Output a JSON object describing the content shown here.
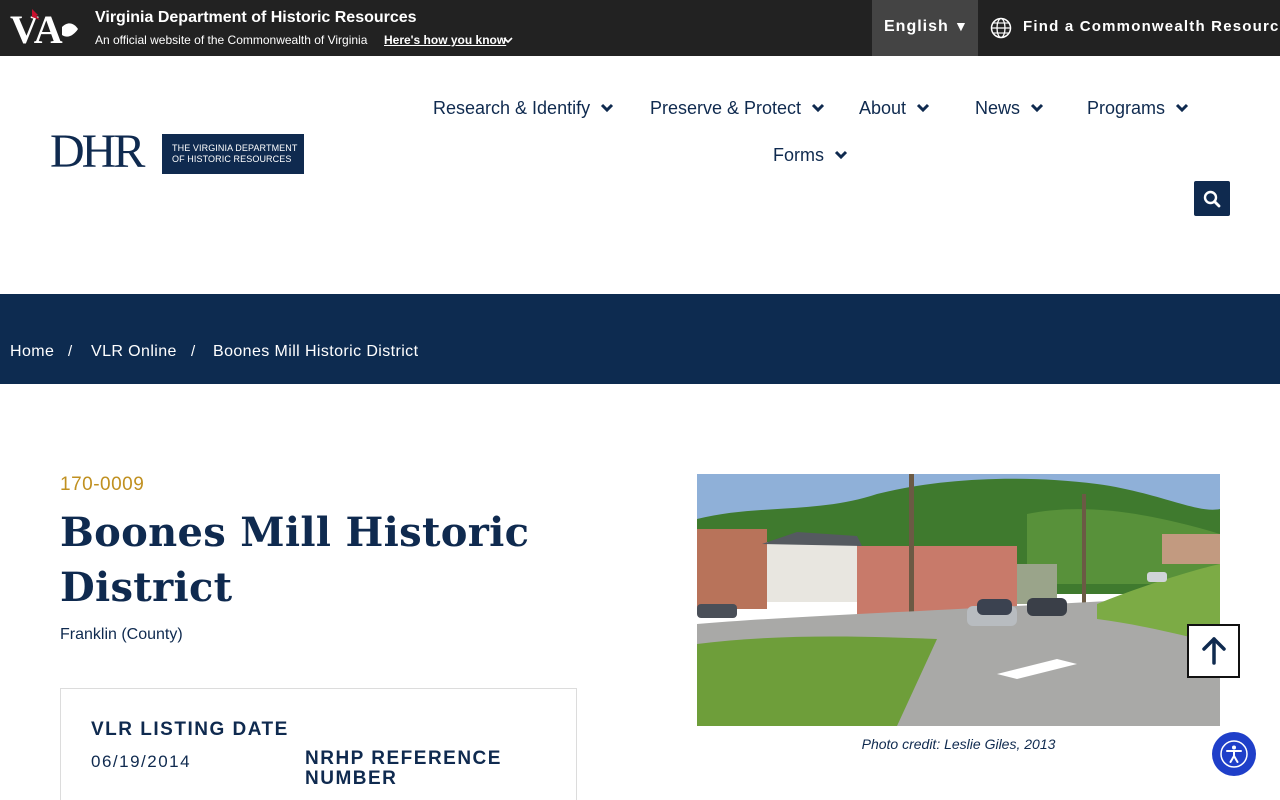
{
  "topbar": {
    "agency_name": "Virginia Department of Historic Resources",
    "official_text": "An official website of the Commonwealth of Virginia",
    "how_you_know": "Here's how you know",
    "language": "English",
    "language_caret": "▼",
    "find_resource": "Find a Commonwealth Resource",
    "va_logo_text": "VA"
  },
  "logo": {
    "letters": "DHR",
    "line1": "THE VIRGINIA DEPARTMENT",
    "line2": "OF HISTORIC RESOURCES"
  },
  "nav": {
    "items": [
      {
        "label": "Research & Identify"
      },
      {
        "label": "Preserve & Protect"
      },
      {
        "label": "About"
      },
      {
        "label": "News"
      },
      {
        "label": "Programs"
      },
      {
        "label": "Forms"
      }
    ]
  },
  "breadcrumb": {
    "items": [
      "Home",
      "VLR Online",
      "Boones Mill Historic District"
    ],
    "separator": "/"
  },
  "resource": {
    "ref_number": "170-0009",
    "title": "Boones Mill Historic District",
    "county": "Franklin (County)",
    "vlr_heading": "VLR LISTING DATE",
    "vlr_date": "06/19/2014",
    "nrhp_heading": "NRHP REFERENCE NUMBER",
    "photo_caption": "Photo credit: Leslie Giles, 2013"
  },
  "colors": {
    "navy": "#0f2a4f",
    "gold": "#c09020",
    "topbar": "#222222",
    "accessibility_blue": "#1f3fc9"
  }
}
